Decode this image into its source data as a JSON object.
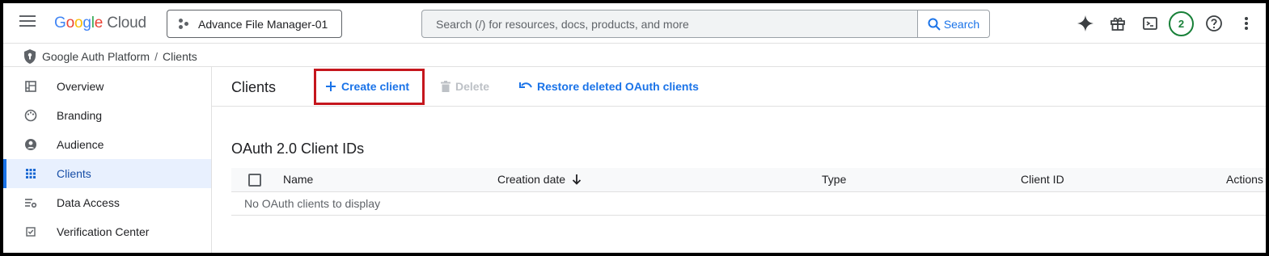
{
  "header": {
    "logo": {
      "g": "G",
      "o1": "o",
      "o2": "o",
      "g2": "g",
      "l": "l",
      "e": "e",
      "cloud": " Cloud"
    },
    "project_name": "Advance File Manager-01",
    "search_placeholder": "Search (/) for resources, docs, products, and more",
    "search_button": "Search",
    "notification_count": "2"
  },
  "breadcrumb": {
    "items": [
      "Google Auth Platform",
      "Clients"
    ],
    "separator": "/"
  },
  "sidebar": {
    "items": [
      {
        "label": "Overview",
        "icon": "dashboard-icon"
      },
      {
        "label": "Branding",
        "icon": "palette-icon"
      },
      {
        "label": "Audience",
        "icon": "account-circle-icon"
      },
      {
        "label": "Clients",
        "icon": "apps-grid-icon",
        "active": true
      },
      {
        "label": "Data Access",
        "icon": "data-access-icon"
      },
      {
        "label": "Verification Center",
        "icon": "checkbox-icon"
      }
    ]
  },
  "main": {
    "title": "Clients",
    "toolbar": {
      "create": "Create client",
      "delete": "Delete",
      "restore": "Restore deleted OAuth clients"
    },
    "section_title": "OAuth 2.0 Client IDs",
    "table": {
      "columns": [
        "Name",
        "Creation date",
        "Type",
        "Client ID",
        "Actions"
      ],
      "empty_message": "No OAuth clients to display"
    }
  },
  "colors": {
    "accent": "#1a73e8",
    "highlight_box": "#c5161d",
    "badge": "#188038"
  }
}
